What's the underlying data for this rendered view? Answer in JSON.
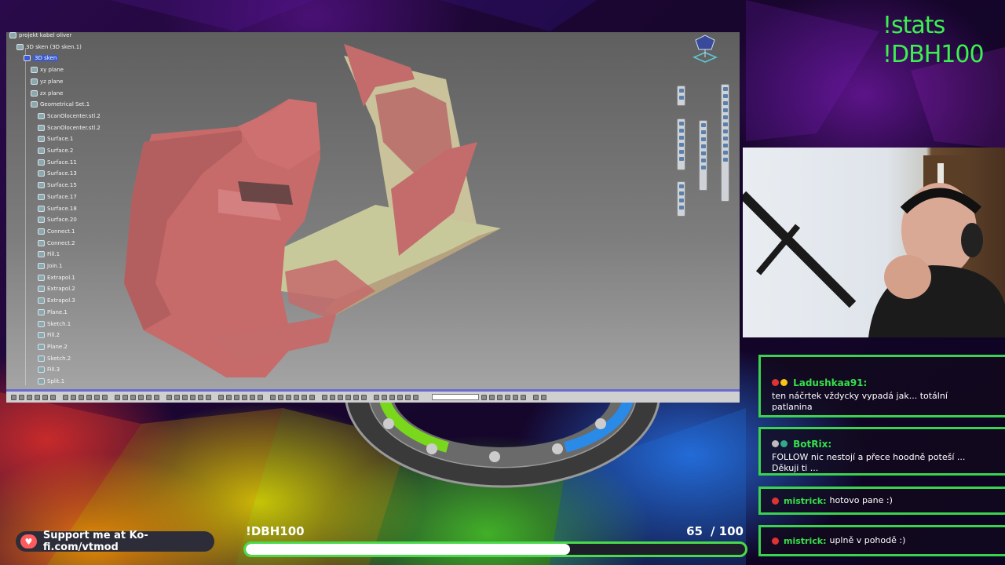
{
  "overlay": {
    "commands": [
      "!stats",
      "!DBH100"
    ],
    "kofi_text": "Support me at Ko-fi.com/vtmod",
    "goal": {
      "label": "!DBH100",
      "current": "65",
      "separator": "/ 100",
      "progress": 0.65
    }
  },
  "cad": {
    "tree_items": [
      {
        "label": "projekt kabel oliver",
        "depth": 0,
        "selected": false
      },
      {
        "label": "3D sken (3D sken.1)",
        "depth": 1,
        "selected": false
      },
      {
        "label": "3D sken",
        "depth": 2,
        "selected": true
      },
      {
        "label": "xy plane",
        "depth": 3,
        "selected": false
      },
      {
        "label": "yz plane",
        "depth": 3,
        "selected": false
      },
      {
        "label": "zx plane",
        "depth": 3,
        "selected": false
      },
      {
        "label": "Geometrical Set.1",
        "depth": 3,
        "selected": false
      },
      {
        "label": "ScanOlocenter.stl.2",
        "depth": 4,
        "selected": false
      },
      {
        "label": "ScanOlocenter.stl.2",
        "depth": 4,
        "selected": false
      },
      {
        "label": "Surface.1",
        "depth": 4,
        "selected": false
      },
      {
        "label": "Surface.2",
        "depth": 4,
        "selected": false
      },
      {
        "label": "Surface.11",
        "depth": 4,
        "selected": false
      },
      {
        "label": "Surface.13",
        "depth": 4,
        "selected": false
      },
      {
        "label": "Surface.15",
        "depth": 4,
        "selected": false
      },
      {
        "label": "Surface.17",
        "depth": 4,
        "selected": false
      },
      {
        "label": "Surface.18",
        "depth": 4,
        "selected": false
      },
      {
        "label": "Surface.20",
        "depth": 4,
        "selected": false
      },
      {
        "label": "Connect.1",
        "depth": 4,
        "selected": false
      },
      {
        "label": "Connect.2",
        "depth": 4,
        "selected": false
      },
      {
        "label": "Fill.1",
        "depth": 4,
        "selected": false
      },
      {
        "label": "Join.1",
        "depth": 4,
        "selected": false
      },
      {
        "label": "Extrapol.1",
        "depth": 4,
        "selected": false
      },
      {
        "label": "Extrapol.2",
        "depth": 4,
        "selected": false
      },
      {
        "label": "Extrapol.3",
        "depth": 4,
        "selected": false
      },
      {
        "label": "Plane.1",
        "depth": 4,
        "selected": false
      },
      {
        "label": "Sketch.1",
        "depth": 4,
        "selected": false
      },
      {
        "label": "Fill.2",
        "depth": 4,
        "selected": false
      },
      {
        "label": "Plane.2",
        "depth": 4,
        "selected": false
      },
      {
        "label": "Sketch.2",
        "depth": 4,
        "selected": false
      },
      {
        "label": "Fill.3",
        "depth": 4,
        "selected": false
      },
      {
        "label": "Split.1",
        "depth": 4,
        "selected": false
      }
    ]
  },
  "chat": {
    "messages": [
      {
        "user": "Ladushkaa91:",
        "text": "ten náčrtek vždycky vypadá jak... totální patlanina",
        "color": "#36e04a"
      },
      {
        "user": "BotRix:",
        "text": "FOLLOW nic nestojí a přece hoodně poteší ... Děkuji ti ...",
        "color": "#36e04a"
      },
      {
        "user": "mistrick:",
        "text": "hotovo pane :)",
        "color": "#36e04a"
      },
      {
        "user": "mistrick:",
        "text": "uplně v pohodě :)",
        "color": "#36e04a"
      }
    ]
  },
  "colors": {
    "accent": "#39d34f",
    "model_red": "#c46b6b",
    "model_olive": "#c8c99a"
  },
  "icons": {
    "kofi": "heart-cup-icon",
    "compass": "compass-icon"
  }
}
